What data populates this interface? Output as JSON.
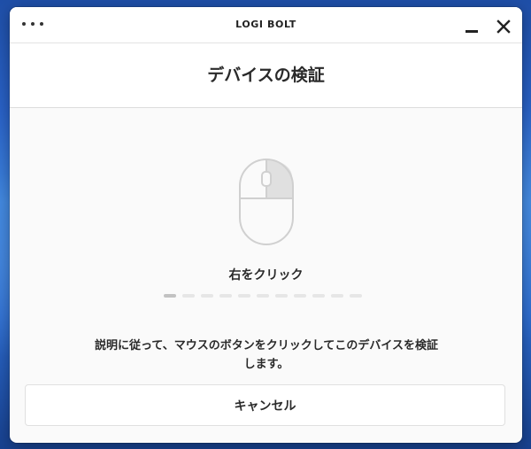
{
  "window": {
    "app_title": "LOGI BOLT",
    "menu_icon": "more-dots-icon",
    "minimize_icon": "minimize-icon",
    "close_icon": "close-icon"
  },
  "header": {
    "title": "デバイスの検証"
  },
  "main": {
    "illustration": "mouse-right-click-icon",
    "step_label": "右をクリック",
    "progress": {
      "total_steps": 11,
      "current_step": 1
    },
    "instruction": "説明に従って、マウスのボタンをクリックしてこのデバイスを検証します。"
  },
  "footer": {
    "cancel_label": "キャンセル"
  },
  "colors": {
    "window_bg": "#fafafa",
    "text": "#2a2a2a",
    "highlight_button": "#e0e0e0",
    "progress_active": "#c2c2c2",
    "progress_inactive": "#e6e6e6"
  }
}
